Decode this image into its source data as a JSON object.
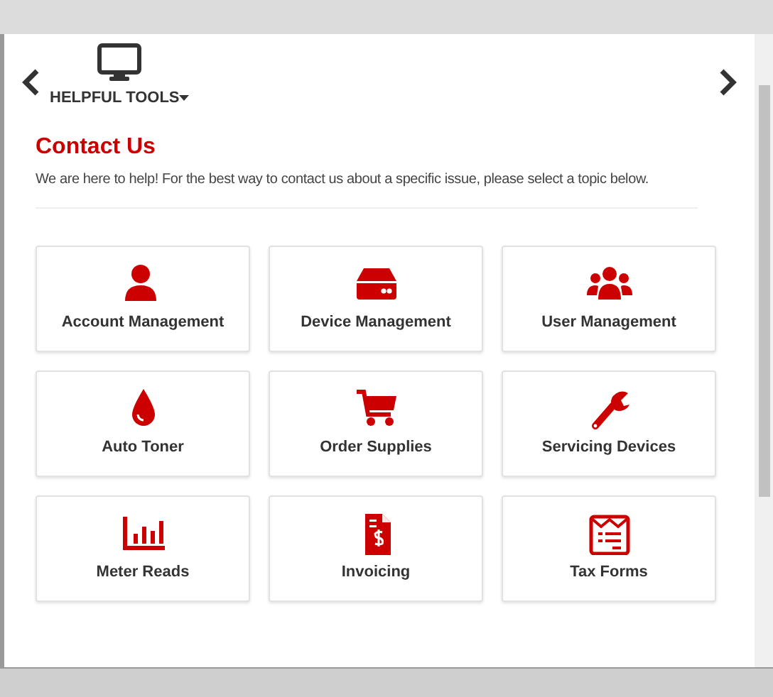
{
  "nav": {
    "menu_label": "HELPFUL TOOLS"
  },
  "section": {
    "title": "Contact Us",
    "intro": "We are here to help! For the best way to contact us about a specific issue, please select a topic below."
  },
  "topics": [
    {
      "label": "Account Management",
      "kind": "person"
    },
    {
      "label": "Device Management",
      "kind": "drive"
    },
    {
      "label": "User Management",
      "kind": "users"
    },
    {
      "label": "Auto Toner",
      "kind": "drop"
    },
    {
      "label": "Order Supplies",
      "kind": "cart"
    },
    {
      "label": "Servicing Devices",
      "kind": "wrench"
    },
    {
      "label": "Meter Reads",
      "kind": "chart"
    },
    {
      "label": "Invoicing",
      "kind": "invoice"
    },
    {
      "label": "Tax Forms",
      "kind": "form"
    }
  ]
}
